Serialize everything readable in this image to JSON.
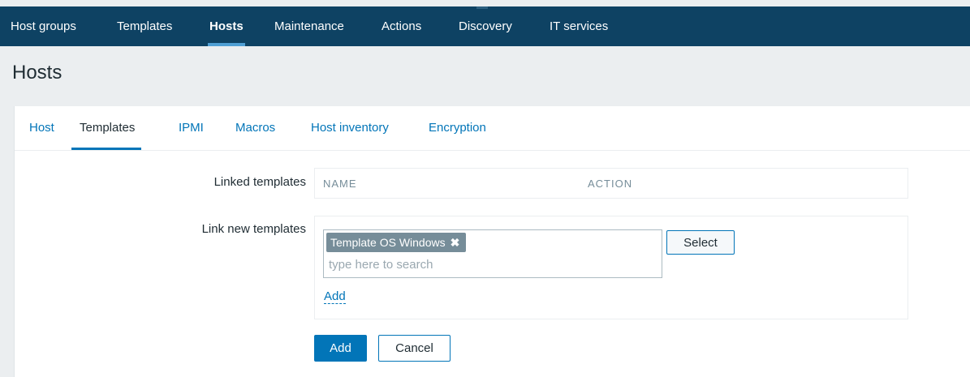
{
  "top_nav": {
    "items": [
      {
        "label": "Host groups",
        "active": false
      },
      {
        "label": "Templates",
        "active": false
      },
      {
        "label": "Hosts",
        "active": true
      },
      {
        "label": "Maintenance",
        "active": false
      },
      {
        "label": "Actions",
        "active": false
      },
      {
        "label": "Discovery",
        "active": false
      },
      {
        "label": "IT services",
        "active": false
      }
    ]
  },
  "page": {
    "title": "Hosts"
  },
  "form_tabs": {
    "items": [
      {
        "label": "Host",
        "active": false
      },
      {
        "label": "Templates",
        "active": true
      },
      {
        "label": "IPMI",
        "active": false
      },
      {
        "label": "Macros",
        "active": false
      },
      {
        "label": "Host inventory",
        "active": false
      },
      {
        "label": "Encryption",
        "active": false
      }
    ]
  },
  "linked_templates": {
    "label": "Linked templates",
    "columns": [
      "NAME",
      "ACTION"
    ]
  },
  "link_new_templates": {
    "label": "Link new templates",
    "selected": [
      {
        "name": "Template OS Windows",
        "remove_glyph": "✖"
      }
    ],
    "search_placeholder": "type here to search",
    "search_value": "",
    "select_label": "Select",
    "add_link_label": "Add"
  },
  "actions": {
    "add_label": "Add",
    "cancel_label": "Cancel"
  },
  "colors": {
    "nav_bg": "#0e4263",
    "nav_active_underline": "#4f9fd4",
    "link_blue": "#0275b8",
    "chip_bg": "#768d99",
    "page_bg": "#ebeef0"
  }
}
